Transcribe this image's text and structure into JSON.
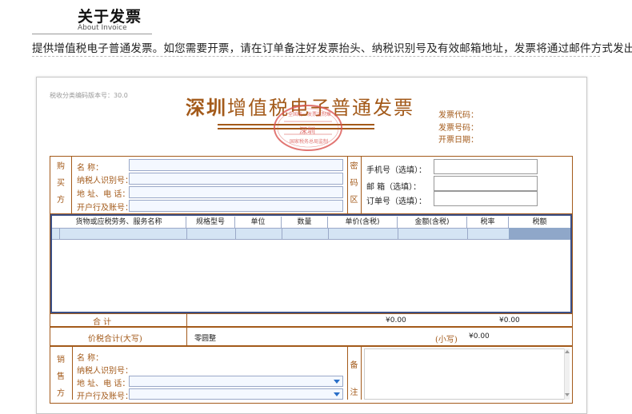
{
  "header": {
    "title": "关于发票",
    "subtitle": "About Invoice",
    "intro": "提供增值税电子普通发票。如您需要开票，请在订单备注好发票抬头、纳税识别号及有效邮箱地址，发票将通过邮件方式发出。"
  },
  "invoice": {
    "version_text": "税收分类编码版本号：30.0",
    "title_bold": "深圳",
    "title_rest": "增值税电子普通发票",
    "seal_top": "全国统一发票监制章",
    "seal_city": "深圳",
    "seal_bottom": "国家税务总局监制",
    "meta": [
      "发票代码：",
      "发票号码：",
      "开票日期："
    ]
  },
  "buyer": {
    "side_label": [
      "购",
      "买",
      "方"
    ],
    "fields": [
      {
        "label": "名        称：",
        "value": ""
      },
      {
        "label": "纳税人识别号：",
        "value": ""
      },
      {
        "label": "地  址、电  话：",
        "value": ""
      },
      {
        "label": "开户行及账号：",
        "value": ""
      }
    ],
    "code_label": [
      "密",
      "码",
      "区"
    ]
  },
  "contact": {
    "phone_label": "手机号（选填）：",
    "email_label": "邮  箱（选填）：",
    "order_label": "订单号（选填）："
  },
  "table": {
    "headers": [
      "货物或应税劳务、服务名称",
      "规格型号",
      "单位",
      "数量",
      "单价(含税)",
      "金额(含税)",
      "税率",
      "税额"
    ]
  },
  "totals": {
    "sum_label": "合        计",
    "amount": "¥0.00",
    "tax": "¥0.00",
    "caps_label": "价税合计(大写)",
    "caps_value": "零圆整",
    "small_label": "(小写)",
    "small_value": "¥0.00"
  },
  "seller": {
    "side_label": [
      "销",
      "售",
      "方"
    ],
    "fields": [
      {
        "label": "名        称：",
        "value": ""
      },
      {
        "label": "纳税人识别号：",
        "value": ""
      },
      {
        "label": "地  址、电  话：",
        "value": ""
      },
      {
        "label": "开户行及账号：",
        "value": ""
      }
    ],
    "remark_label": [
      "备",
      "注"
    ]
  }
}
